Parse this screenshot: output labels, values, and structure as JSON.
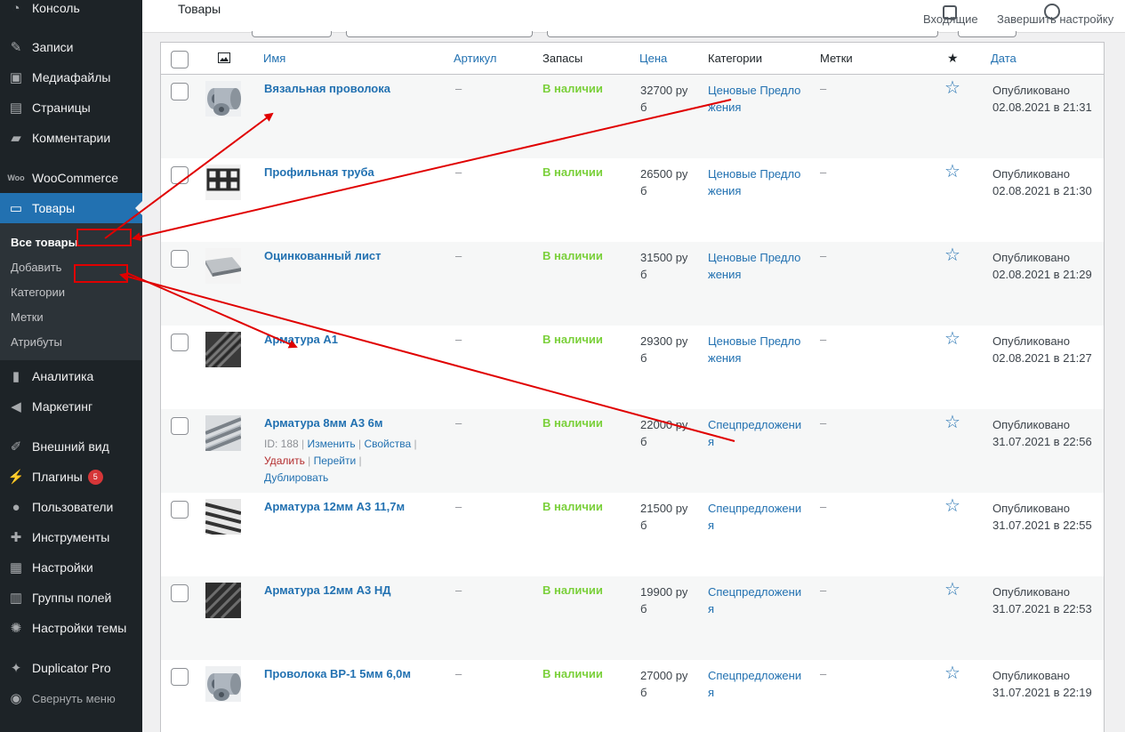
{
  "sidebar": {
    "items": [
      {
        "label": "Консоль",
        "icon": "dashboard-icon"
      },
      {
        "label": "Записи",
        "icon": "pin-icon"
      },
      {
        "label": "Медиафайлы",
        "icon": "media-icon"
      },
      {
        "label": "Страницы",
        "icon": "page-icon"
      },
      {
        "label": "Комментарии",
        "icon": "comment-icon"
      },
      {
        "label": "WooCommerce",
        "icon": "woo-icon"
      },
      {
        "label": "Товары",
        "icon": "archive-icon"
      },
      {
        "label": "Аналитика",
        "icon": "analytics-icon"
      },
      {
        "label": "Маркетинг",
        "icon": "megaphone-icon"
      },
      {
        "label": "Внешний вид",
        "icon": "brush-icon"
      },
      {
        "label": "Плагины",
        "icon": "plugin-icon",
        "badge": "5"
      },
      {
        "label": "Пользователи",
        "icon": "users-icon"
      },
      {
        "label": "Инструменты",
        "icon": "wrench-icon"
      },
      {
        "label": "Настройки",
        "icon": "settings-icon"
      },
      {
        "label": "Группы полей",
        "icon": "fields-icon"
      },
      {
        "label": "Настройки темы",
        "icon": "gear-icon"
      },
      {
        "label": "Duplicator Pro",
        "icon": "duplicator-icon"
      },
      {
        "label": "Свернуть меню",
        "icon": "collapse-icon"
      }
    ],
    "submenu": [
      "Все товары",
      "Добавить",
      "Категории",
      "Метки",
      "Атрибуты"
    ]
  },
  "header": {
    "title": "Товары",
    "inbox_label": "Входящие",
    "finish_label": "Завершить настройку"
  },
  "table": {
    "columns": {
      "image": "image-icon",
      "name": "Имя",
      "sku": "Артикул",
      "stock": "Запасы",
      "price": "Цена",
      "categories": "Категории",
      "tags": "Метки",
      "featured": "★",
      "date": "Дата"
    },
    "rows": [
      {
        "name": "Вязальная проволока",
        "sku": "–",
        "stock": "В наличии",
        "price": "32700 руб",
        "category": "Ценовые Предложения",
        "tags": "–",
        "date": "Опубликовано 02.08.2021 в 21:31"
      },
      {
        "name": "Профильная труба",
        "sku": "–",
        "stock": "В наличии",
        "price": "26500 руб",
        "category": "Ценовые Предложения",
        "tags": "–",
        "date": "Опубликовано 02.08.2021 в 21:30"
      },
      {
        "name": "Оцинкованный лист",
        "sku": "–",
        "stock": "В наличии",
        "price": "31500 руб",
        "category": "Ценовые Предложения",
        "tags": "–",
        "date": "Опубликовано 02.08.2021 в 21:29"
      },
      {
        "name": "Арматура А1",
        "sku": "–",
        "stock": "В наличии",
        "price": "29300 руб",
        "category": "Ценовые Предложения",
        "tags": "–",
        "date": "Опубликовано 02.08.2021 в 21:27"
      },
      {
        "name": "Арматура 8мм А3 6м",
        "sku": "–",
        "stock": "В наличии",
        "price": "22000 руб",
        "category": "Спецпредложения",
        "tags": "–",
        "date": "Опубликовано 31.07.2021 в 22:56",
        "actions": {
          "id": "ID: 188",
          "edit": "Изменить",
          "props": "Свойства",
          "delete": "Удалить",
          "goto": "Перейти",
          "duplicate": "Дублировать"
        }
      },
      {
        "name": "Арматура 12мм А3 11,7м",
        "sku": "–",
        "stock": "В наличии",
        "price": "21500 руб",
        "category": "Спецпредложения",
        "tags": "–",
        "date": "Опубликовано 31.07.2021 в 22:55"
      },
      {
        "name": "Арматура 12мм А3 НД",
        "sku": "–",
        "stock": "В наличии",
        "price": "19900 руб",
        "category": "Спецпредложения",
        "tags": "–",
        "date": "Опубликовано 31.07.2021 в 22:53"
      },
      {
        "name": "Проволока ВР-1 5мм 6,0м",
        "sku": "–",
        "stock": "В наличии",
        "price": "27000 руб",
        "category": "Спецпредложения",
        "tags": "–",
        "date": "Опубликовано 31.07.2021 в 22:19"
      }
    ]
  },
  "colors": {
    "sidebar_bg": "#1d2327",
    "accent": "#2271b1",
    "in_stock": "#7ad03a",
    "annotation_red": "#e00000"
  }
}
